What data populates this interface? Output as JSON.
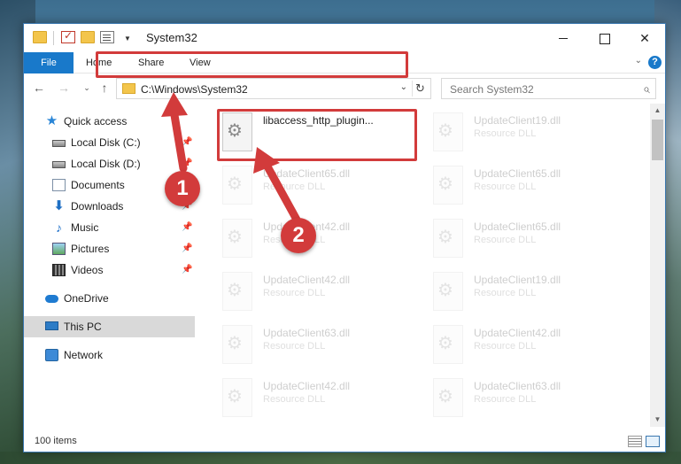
{
  "window": {
    "title": "System32"
  },
  "ribbon": {
    "tabs": [
      "File",
      "Home",
      "Share",
      "View"
    ]
  },
  "address": {
    "path": "C:\\Windows\\System32"
  },
  "search": {
    "placeholder": "Search System32"
  },
  "sidebar": {
    "items": [
      {
        "label": "Quick access",
        "icon": "quick-access-star-icon"
      },
      {
        "label": "Local Disk (C:)",
        "icon": "drive-icon",
        "pinned": true
      },
      {
        "label": "Local Disk (D:)",
        "icon": "drive-icon",
        "pinned": true
      },
      {
        "label": "Documents",
        "icon": "documents-icon",
        "pinned": true
      },
      {
        "label": "Downloads",
        "icon": "downloads-icon",
        "pinned": true
      },
      {
        "label": "Music",
        "icon": "music-icon",
        "pinned": true
      },
      {
        "label": "Pictures",
        "icon": "pictures-icon",
        "pinned": true
      },
      {
        "label": "Videos",
        "icon": "videos-icon",
        "pinned": true
      },
      {
        "label": "OneDrive",
        "icon": "onedrive-cloud-icon"
      },
      {
        "label": "This PC",
        "icon": "this-pc-icon",
        "selected": true
      },
      {
        "label": "Network",
        "icon": "network-icon"
      }
    ]
  },
  "files": [
    {
      "name": "libaccess_http_plugin...",
      "type": ""
    },
    {
      "name": "UpdateClient19.dll",
      "type": "Resource DLL"
    },
    {
      "name": "UpdateClient65.dll",
      "type": "Resource DLL"
    },
    {
      "name": "UpdateClient65.dll",
      "type": "Resource DLL"
    },
    {
      "name": "UpdateClient42.dll",
      "type": "Resource DLL"
    },
    {
      "name": "UpdateClient65.dll",
      "type": "Resource DLL"
    },
    {
      "name": "UpdateClient42.dll",
      "type": "Resource DLL"
    },
    {
      "name": "UpdateClient19.dll",
      "type": "Resource DLL"
    },
    {
      "name": "UpdateClient63.dll",
      "type": "Resource DLL"
    },
    {
      "name": "UpdateClient42.dll",
      "type": "Resource DLL"
    },
    {
      "name": "UpdateClient42.dll",
      "type": "Resource DLL"
    },
    {
      "name": "UpdateClient63.dll",
      "type": "Resource DLL"
    }
  ],
  "status": {
    "item_count": "100 items"
  },
  "callouts": [
    "1",
    "2"
  ],
  "colors": {
    "accent": "#1979ca",
    "highlight": "#d23b3b"
  }
}
